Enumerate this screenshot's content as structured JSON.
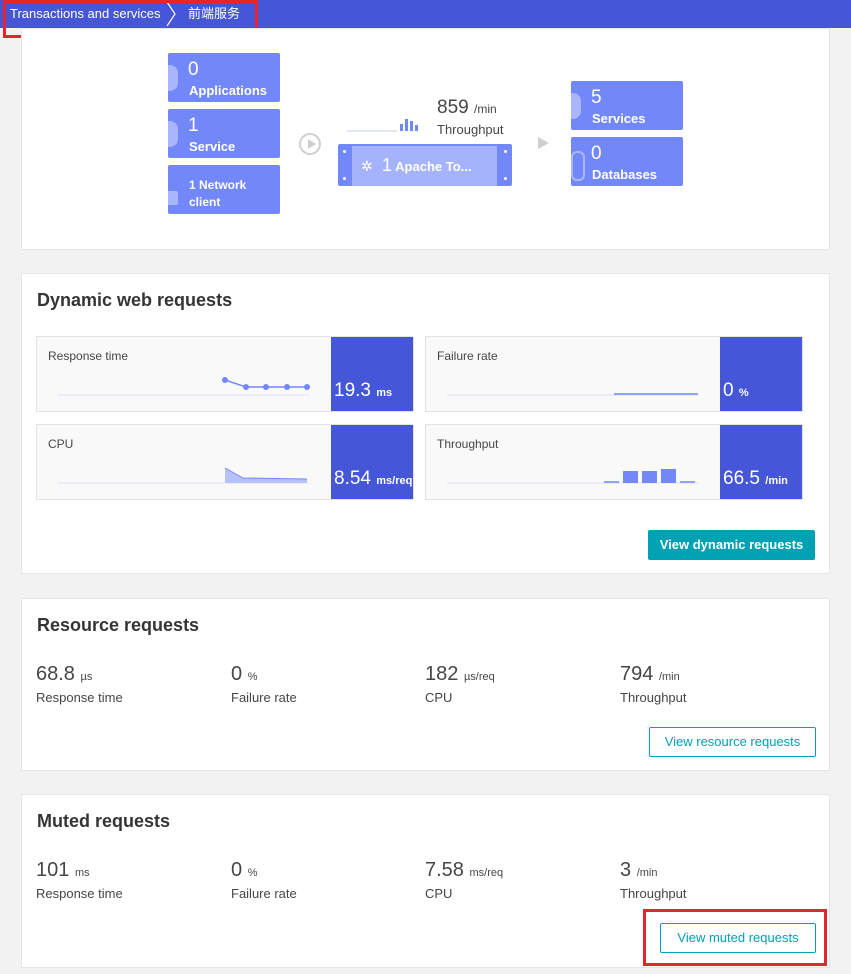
{
  "breadcrumb": {
    "parent": "Transactions and services",
    "current": "前端服务"
  },
  "topology": {
    "applications": {
      "count": "0",
      "label": "Applications"
    },
    "service": {
      "count": "1",
      "label": "Service"
    },
    "network_client": {
      "line1": "1 Network",
      "line2": "client"
    },
    "throughput": {
      "value": "859",
      "unit": "/min",
      "label": "Throughput"
    },
    "process": {
      "count": "1",
      "label": "Apache To..."
    },
    "services": {
      "count": "5",
      "label": "Services"
    },
    "databases": {
      "count": "0",
      "label": "Databases"
    }
  },
  "dynamic": {
    "title": "Dynamic web requests",
    "response_time": {
      "label": "Response time",
      "value": "19.3",
      "unit": "ms"
    },
    "failure_rate": {
      "label": "Failure rate",
      "value": "0",
      "unit": "%"
    },
    "cpu": {
      "label": "CPU",
      "value": "8.54",
      "unit": "ms/req"
    },
    "throughput": {
      "label": "Throughput",
      "value": "66.5",
      "unit": "/min"
    },
    "button": "View dynamic requests"
  },
  "resource": {
    "title": "Resource requests",
    "stats": [
      {
        "value": "68.8",
        "unit": "µs",
        "label": "Response time"
      },
      {
        "value": "0",
        "unit": "%",
        "label": "Failure rate"
      },
      {
        "value": "182",
        "unit": "µs/req",
        "label": "CPU"
      },
      {
        "value": "794",
        "unit": "/min",
        "label": "Throughput"
      }
    ],
    "button": "View resource requests"
  },
  "muted": {
    "title": "Muted requests",
    "stats": [
      {
        "value": "101",
        "unit": "ms",
        "label": "Response time"
      },
      {
        "value": "0",
        "unit": "%",
        "label": "Failure rate"
      },
      {
        "value": "7.58",
        "unit": "ms/req",
        "label": "CPU"
      },
      {
        "value": "3",
        "unit": "/min",
        "label": "Throughput"
      }
    ],
    "button": "View muted requests"
  },
  "colors": {
    "brand": "#4556d6",
    "tile": "#7388f8",
    "accent": "#00a1b2",
    "highlight": "#e8222f"
  }
}
